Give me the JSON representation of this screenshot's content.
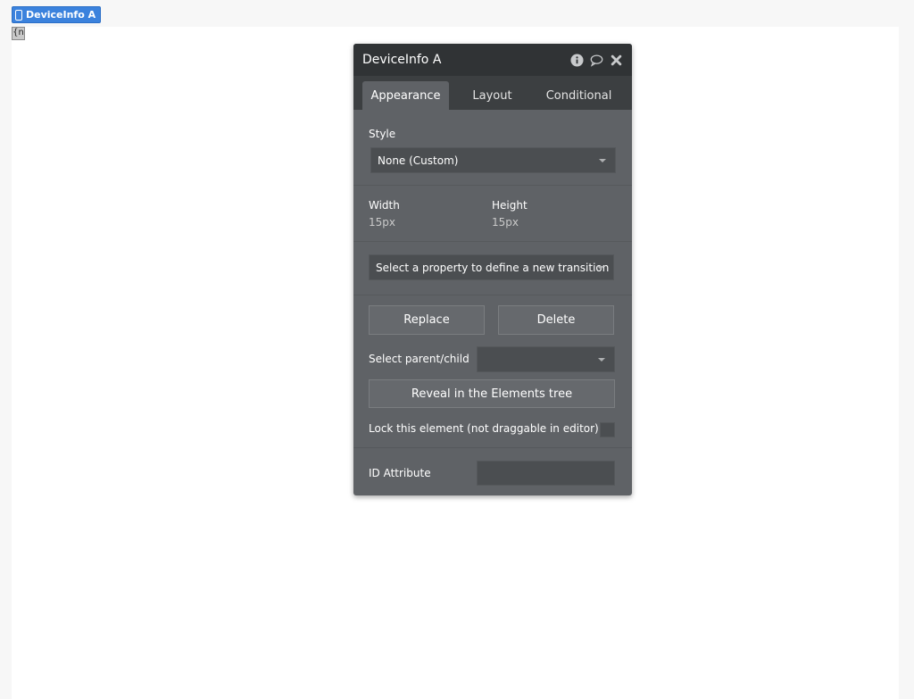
{
  "element_tag": {
    "label": "DeviceInfo A"
  },
  "device_element": {
    "glyph": "{n"
  },
  "panel": {
    "title": "DeviceInfo A",
    "header_icons": [
      "info-icon",
      "comment-icon",
      "close-icon"
    ],
    "tabs": [
      {
        "label": "Appearance",
        "active": true
      },
      {
        "label": "Layout",
        "active": false
      },
      {
        "label": "Conditional",
        "active": false
      }
    ],
    "style": {
      "label": "Style",
      "value": "None (Custom)"
    },
    "dimensions": {
      "width_label": "Width",
      "width_value": "15px",
      "height_label": "Height",
      "height_value": "15px"
    },
    "transition": {
      "placeholder": "Select a property to define a new transition"
    },
    "buttons": {
      "replace": "Replace",
      "delete": "Delete"
    },
    "parent_child": {
      "label": "Select parent/child",
      "value": ""
    },
    "reveal": {
      "label": "Reveal in the Elements tree"
    },
    "lock": {
      "label": "Lock this element (not draggable in editor)",
      "checked": false
    },
    "id_attribute": {
      "label": "ID Attribute",
      "value": ""
    }
  },
  "colors": {
    "accent": "#3b82dd",
    "panel_bg": "#5f6266",
    "header_bg": "#303335",
    "tabs_bg": "#3c3f41"
  }
}
